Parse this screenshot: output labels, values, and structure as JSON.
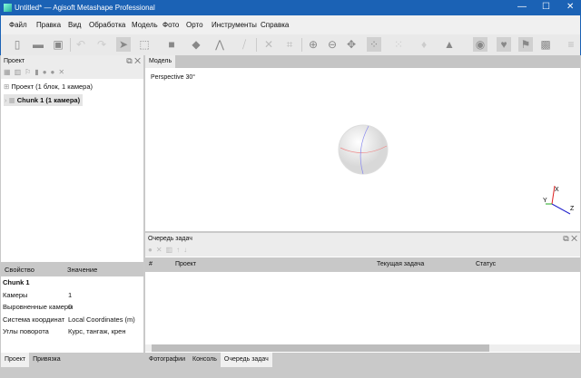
{
  "window": {
    "title": "Untitled* — Agisoft Metashape Professional",
    "minimize": "—",
    "maximize": "☐",
    "close": "✕"
  },
  "menu": [
    "Файл",
    "Правка",
    "Вид",
    "Обработка",
    "Модель",
    "Фото",
    "Орто",
    "Инструменты",
    "Справка"
  ],
  "toolbar": [
    "new-icon",
    "open-icon",
    "save-icon",
    "undo-icon",
    "redo-icon",
    "select-icon",
    "rect-select-icon",
    "shape-icon",
    "fill-icon",
    "ruler-icon",
    "eraser-icon",
    "delete-icon",
    "crop-icon",
    "zoom-in-icon",
    "zoom-out-icon",
    "move-icon",
    "points-icon",
    "sparse-icon",
    "tiepoints-icon",
    "mesh-icon",
    "camera-icon",
    "model-icon",
    "flag-icon",
    "image-icon",
    "layers-icon"
  ],
  "project_panel": {
    "title": "Проект",
    "tree": {
      "root": "Проект (1 блок, 1 камера)",
      "chunk": "Chunk 1 (1 камера)"
    }
  },
  "properties": {
    "headers": [
      "Свойство",
      "Значение"
    ],
    "chunk": "Chunk 1",
    "rows": [
      [
        "Камеры",
        "1"
      ],
      [
        "Выровненные камеры",
        "0"
      ],
      [
        "Система координат",
        "Local Coordinates (m)"
      ],
      [
        "Углы поворота",
        "Курс, тангаж, крен"
      ]
    ]
  },
  "left_tabs": [
    "Проект",
    "Привязка"
  ],
  "view": {
    "tab": "Модель",
    "label": "Perspective 30°",
    "axes": {
      "x": "X",
      "y": "Y",
      "z": "Z"
    }
  },
  "queue": {
    "title": "Очередь задач",
    "columns": [
      "#",
      "Проект",
      "Текущая задача",
      "Статус"
    ]
  },
  "bottom_tabs": [
    "Фотографии",
    "Консоль",
    "Очередь задач"
  ],
  "colors": {
    "titlebar": "#1b62b5",
    "x_axis": "#d22",
    "y_axis": "#2a2",
    "z_axis": "#22c"
  }
}
